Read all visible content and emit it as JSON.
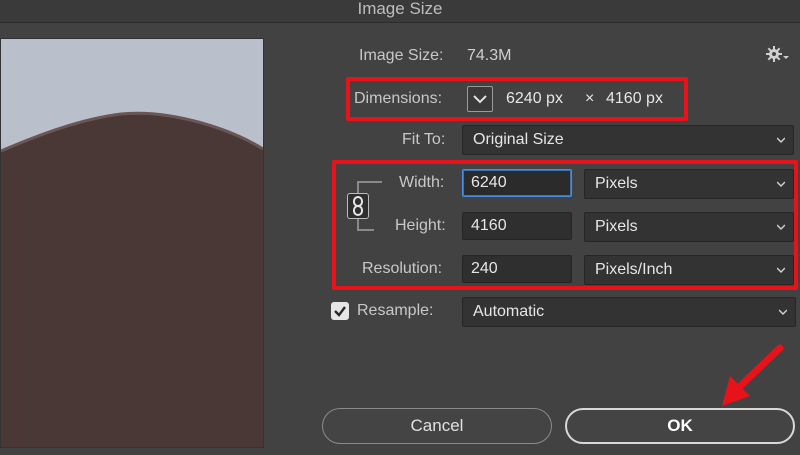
{
  "window": {
    "title": "Image Size"
  },
  "info": {
    "image_size_label": "Image Size:",
    "image_size_value": "74.3M"
  },
  "dimensions": {
    "label": "Dimensions:",
    "width": "6240 px",
    "times": "×",
    "height": "4160 px"
  },
  "fit_to": {
    "label": "Fit To:",
    "value": "Original Size"
  },
  "width": {
    "label": "Width:",
    "value": "6240",
    "unit": "Pixels"
  },
  "height": {
    "label": "Height:",
    "value": "4160",
    "unit": "Pixels"
  },
  "resolution": {
    "label": "Resolution:",
    "value": "240",
    "unit": "Pixels/Inch"
  },
  "resample": {
    "label": "Resample:",
    "checked": true,
    "value": "Automatic"
  },
  "buttons": {
    "cancel": "Cancel",
    "ok": "OK"
  },
  "colors": {
    "annotation": "#e8121b",
    "focus": "#4a90e2",
    "background": "#424242"
  },
  "icons": [
    "gear-icon",
    "chevron-down-icon",
    "link-icon",
    "checkbox-icon",
    "arrow-annotation"
  ]
}
